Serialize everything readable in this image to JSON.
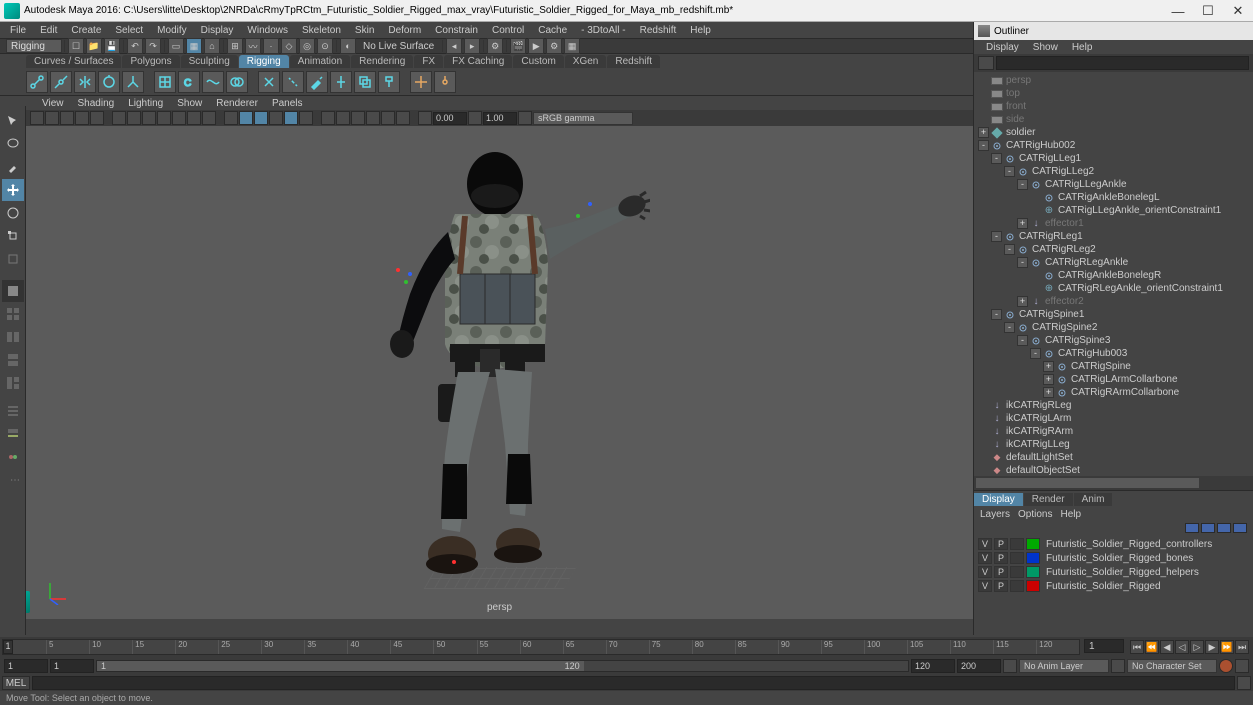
{
  "title": "Autodesk Maya 2016: C:\\Users\\litte\\Desktop\\2NRDa\\cRmyTpRCtm_Futuristic_Soldier_Rigged_max_vray\\Futuristic_Soldier_Rigged_for_Maya_mb_redshift.mb*",
  "menubar": [
    "File",
    "Edit",
    "Create",
    "Select",
    "Modify",
    "Display",
    "Windows",
    "Skeleton",
    "Skin",
    "Deform",
    "Constrain",
    "Control",
    "Cache",
    "- 3DtoAll -",
    "Redshift",
    "Help"
  ],
  "mode_selector": "Rigging",
  "no_live_surface": "No Live Surface",
  "shelves": [
    "Curves / Surfaces",
    "Polygons",
    "Sculpting",
    "Rigging",
    "Animation",
    "Rendering",
    "FX",
    "FX Caching",
    "Custom",
    "XGen",
    "Redshift"
  ],
  "active_shelf": "Rigging",
  "vp_menu": [
    "View",
    "Shading",
    "Lighting",
    "Show",
    "Renderer",
    "Panels"
  ],
  "vp_gamma_val1": "0.00",
  "vp_gamma_val2": "1.00",
  "color_mgmt": "sRGB gamma",
  "camera_label": "persp",
  "outliner": {
    "title": "Outliner",
    "menu": [
      "Display",
      "Show",
      "Help"
    ],
    "items": [
      {
        "d": 0,
        "e": "",
        "t": "cam",
        "n": "persp",
        "dim": true
      },
      {
        "d": 0,
        "e": "",
        "t": "cam",
        "n": "top",
        "dim": true
      },
      {
        "d": 0,
        "e": "",
        "t": "cam",
        "n": "front",
        "dim": true
      },
      {
        "d": 0,
        "e": "",
        "t": "cam",
        "n": "side",
        "dim": true
      },
      {
        "d": 0,
        "e": "+",
        "t": "mesh",
        "n": "soldier"
      },
      {
        "d": 0,
        "e": "-",
        "t": "joint",
        "n": "CATRigHub002"
      },
      {
        "d": 1,
        "e": "-",
        "t": "joint",
        "n": "CATRigLLeg1"
      },
      {
        "d": 2,
        "e": "-",
        "t": "joint",
        "n": "CATRigLLeg2"
      },
      {
        "d": 3,
        "e": "-",
        "t": "joint",
        "n": "CATRigLLegAnkle"
      },
      {
        "d": 4,
        "e": "",
        "t": "joint",
        "n": "CATRigAnkleBonelegL"
      },
      {
        "d": 4,
        "e": "",
        "t": "con",
        "n": "CATRigLLegAnkle_orientConstraint1"
      },
      {
        "d": 3,
        "e": "+",
        "t": "ik",
        "n": "effector1",
        "dim": true
      },
      {
        "d": 1,
        "e": "-",
        "t": "joint",
        "n": "CATRigRLeg1"
      },
      {
        "d": 2,
        "e": "-",
        "t": "joint",
        "n": "CATRigRLeg2"
      },
      {
        "d": 3,
        "e": "-",
        "t": "joint",
        "n": "CATRigRLegAnkle"
      },
      {
        "d": 4,
        "e": "",
        "t": "joint",
        "n": "CATRigAnkleBonelegR"
      },
      {
        "d": 4,
        "e": "",
        "t": "con",
        "n": "CATRigRLegAnkle_orientConstraint1"
      },
      {
        "d": 3,
        "e": "+",
        "t": "ik",
        "n": "effector2",
        "dim": true
      },
      {
        "d": 1,
        "e": "-",
        "t": "joint",
        "n": "CATRigSpine1"
      },
      {
        "d": 2,
        "e": "-",
        "t": "joint",
        "n": "CATRigSpine2"
      },
      {
        "d": 3,
        "e": "-",
        "t": "joint",
        "n": "CATRigSpine3"
      },
      {
        "d": 4,
        "e": "-",
        "t": "joint",
        "n": "CATRigHub003"
      },
      {
        "d": 5,
        "e": "+",
        "t": "joint",
        "n": "CATRigSpine"
      },
      {
        "d": 5,
        "e": "+",
        "t": "joint",
        "n": "CATRigLArmCollarbone"
      },
      {
        "d": 5,
        "e": "+",
        "t": "joint",
        "n": "CATRigRArmCollarbone"
      },
      {
        "d": 0,
        "e": "",
        "t": "ik",
        "n": "ikCATRigRLeg"
      },
      {
        "d": 0,
        "e": "",
        "t": "ik",
        "n": "ikCATRigLArm"
      },
      {
        "d": 0,
        "e": "",
        "t": "ik",
        "n": "ikCATRigRArm"
      },
      {
        "d": 0,
        "e": "",
        "t": "ik",
        "n": "ikCATRigLLeg"
      },
      {
        "d": 0,
        "e": "",
        "t": "set",
        "n": "defaultLightSet"
      },
      {
        "d": 0,
        "e": "",
        "t": "set",
        "n": "defaultObjectSet"
      }
    ]
  },
  "channel": {
    "tabs": [
      "Display",
      "Render",
      "Anim"
    ],
    "menu": [
      "Layers",
      "Options",
      "Help"
    ],
    "layers": [
      {
        "v": "V",
        "p": "P",
        "c": "#00aa00",
        "n": "Futuristic_Soldier_Rigged_controllers"
      },
      {
        "v": "V",
        "p": "P",
        "c": "#0033cc",
        "n": "Futuristic_Soldier_Rigged_bones"
      },
      {
        "v": "V",
        "p": "P",
        "c": "#009966",
        "n": "Futuristic_Soldier_Rigged_helpers"
      },
      {
        "v": "V",
        "p": "P",
        "c": "#cc0000",
        "n": "Futuristic_Soldier_Rigged"
      }
    ]
  },
  "timeline": {
    "ticks": [
      "1",
      "5",
      "10",
      "15",
      "20",
      "25",
      "30",
      "35",
      "40",
      "45",
      "50",
      "55",
      "60",
      "65",
      "70",
      "75",
      "80",
      "85",
      "90",
      "95",
      "100",
      "105",
      "110",
      "115",
      "120"
    ],
    "current": "1",
    "current_frame_field": "1",
    "range_start_out": "1",
    "range_start_in": "1",
    "range_label_low": "1",
    "range_label_high": "120",
    "range_end_in": "120",
    "range_end_out": "200",
    "anim_layer": "No Anim Layer",
    "char_set": "No Character Set"
  },
  "cmd_lang": "MEL",
  "help_line": "Move Tool: Select an object to move."
}
